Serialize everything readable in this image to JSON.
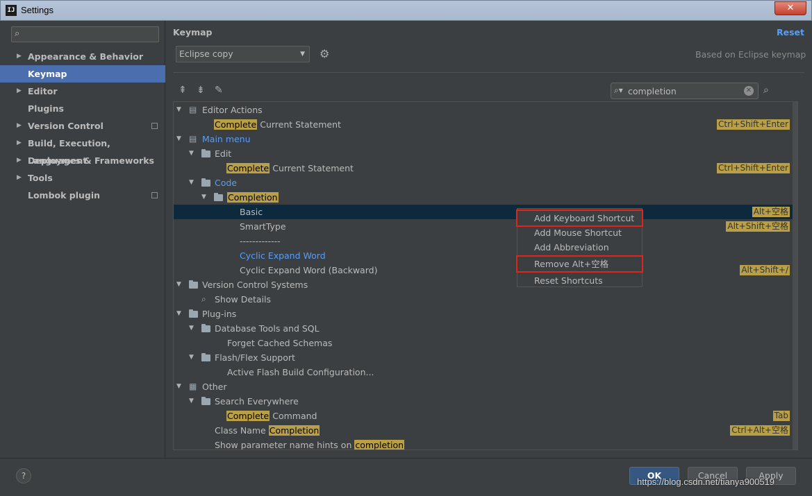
{
  "window": {
    "app_icon": "IJ",
    "title": "Settings",
    "close_symbol": "✕"
  },
  "sidebar": {
    "search_placeholder": "",
    "items": [
      {
        "label": "Appearance & Behavior",
        "expandable": true
      },
      {
        "label": "Keymap",
        "selected": true
      },
      {
        "label": "Editor",
        "expandable": true
      },
      {
        "label": "Plugins"
      },
      {
        "label": "Version Control",
        "expandable": true,
        "project_icon": true
      },
      {
        "label": "Build, Execution, Deployment",
        "expandable": true
      },
      {
        "label": "Languages & Frameworks",
        "expandable": true
      },
      {
        "label": "Tools",
        "expandable": true
      },
      {
        "label": "Lombok plugin",
        "project_icon": true
      }
    ]
  },
  "panel": {
    "title": "Keymap",
    "reset_label": "Reset",
    "keymap_value": "Eclipse copy",
    "based_on": "Based on Eclipse keymap",
    "filter_value": "completion"
  },
  "tree": {
    "rows": [
      {
        "label": "Editor Actions"
      },
      {
        "pre": "",
        "hl": "Complete",
        "post": " Current Statement",
        "shortcut": "Ctrl+Shift+Enter"
      },
      {
        "label": "Main menu"
      },
      {
        "label": "Edit"
      },
      {
        "pre": "",
        "hl": "Complete",
        "post": " Current Statement",
        "shortcut": "Ctrl+Shift+Enter"
      },
      {
        "label": "Code"
      },
      {
        "pre": "",
        "hl": "Completion",
        "post": ""
      },
      {
        "label": "Basic",
        "shortcut": "Alt+空格"
      },
      {
        "label": "SmartType",
        "shortcut": "Alt+Shift+空格"
      },
      {
        "label": "-------------"
      },
      {
        "label": "Cyclic Expand Word"
      },
      {
        "label": "Cyclic Expand Word (Backward)",
        "shortcut": "Alt+Shift+/"
      },
      {
        "label": "Version Control Systems"
      },
      {
        "label": "Show Details"
      },
      {
        "label": "Plug-ins"
      },
      {
        "label": "Database Tools and SQL"
      },
      {
        "label": "Forget Cached Schemas"
      },
      {
        "label": "Flash/Flex Support"
      },
      {
        "label": "Active Flash Build Configuration..."
      },
      {
        "label": "Other"
      },
      {
        "label": "Search Everywhere"
      },
      {
        "pre": "",
        "hl": "Complete",
        "post": " Command",
        "shortcut": "Tab"
      },
      {
        "pre": "Class Name ",
        "hl": "Completion",
        "post": "",
        "shortcut": "Ctrl+Alt+空格"
      },
      {
        "pre": "Show parameter name hints on ",
        "hl": "completion",
        "post": ""
      }
    ]
  },
  "context_menu": {
    "items": [
      "Add Keyboard Shortcut",
      "Add Mouse Shortcut",
      "Add Abbreviation",
      "Remove Alt+空格",
      "Reset Shortcuts"
    ],
    "highlight_color": "#e0251a"
  },
  "footer": {
    "help_label": "?",
    "ok_label": "OK",
    "cancel_label": "Cancel",
    "apply_label": "Apply",
    "watermark": "https://blog.csdn.net/tianya900519"
  },
  "colors": {
    "background": "#3c3f41",
    "selection": "#4b6eaf",
    "tree_selection": "#0d293e",
    "link": "#589df6",
    "match_highlight": "#b99f45"
  }
}
